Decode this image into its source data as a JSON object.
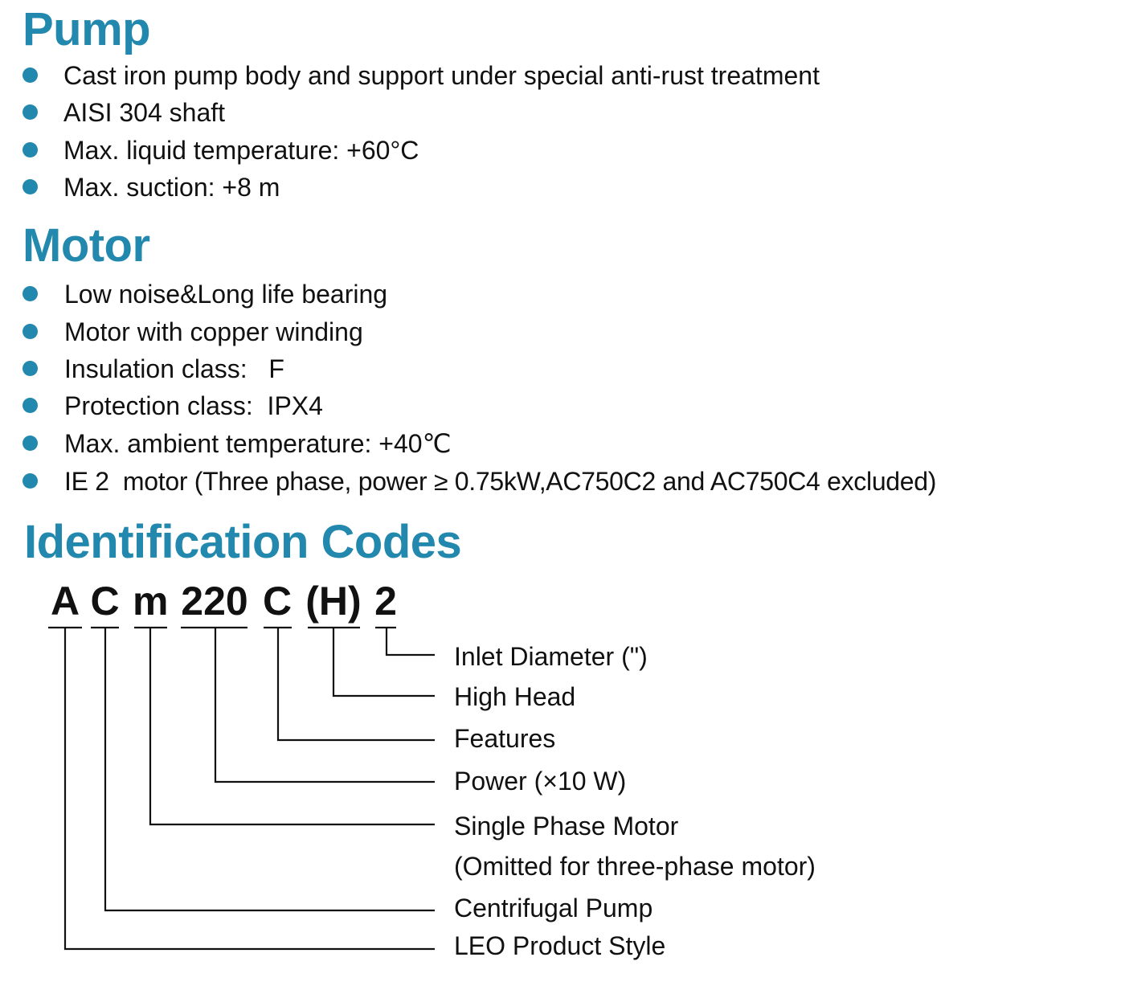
{
  "accent_color": "#2388ad",
  "pump": {
    "title": "Pump",
    "items": [
      "Cast iron pump body and support under special anti-rust treatment",
      "AISI 304 shaft",
      "Max. liquid temperature: +60°C",
      "Max. suction: +8 m"
    ]
  },
  "motor": {
    "title": "Motor",
    "items": [
      "Low noise&Long life bearing",
      "Motor with copper winding",
      "Insulation class:   F",
      "Protection class:  IPX4",
      "Max. ambient temperature: +40℃",
      "IE 2  motor (Three phase, power ≥ 0.75kW,AC750C2 and AC750C4 excluded)"
    ]
  },
  "identification": {
    "title": "Identification Codes",
    "code_segments": [
      "A",
      "C",
      "m",
      "220",
      "C",
      "(H)",
      "2"
    ],
    "labels": {
      "inlet": "Inlet Diameter (\")",
      "high_head": "High Head",
      "features": "Features",
      "power": "Power (×10 W)",
      "single_phase": "Single Phase Motor",
      "single_phase_note": "(Omitted for three-phase motor)",
      "centrifugal": "Centrifugal Pump",
      "leo": "LEO Product Style"
    }
  }
}
